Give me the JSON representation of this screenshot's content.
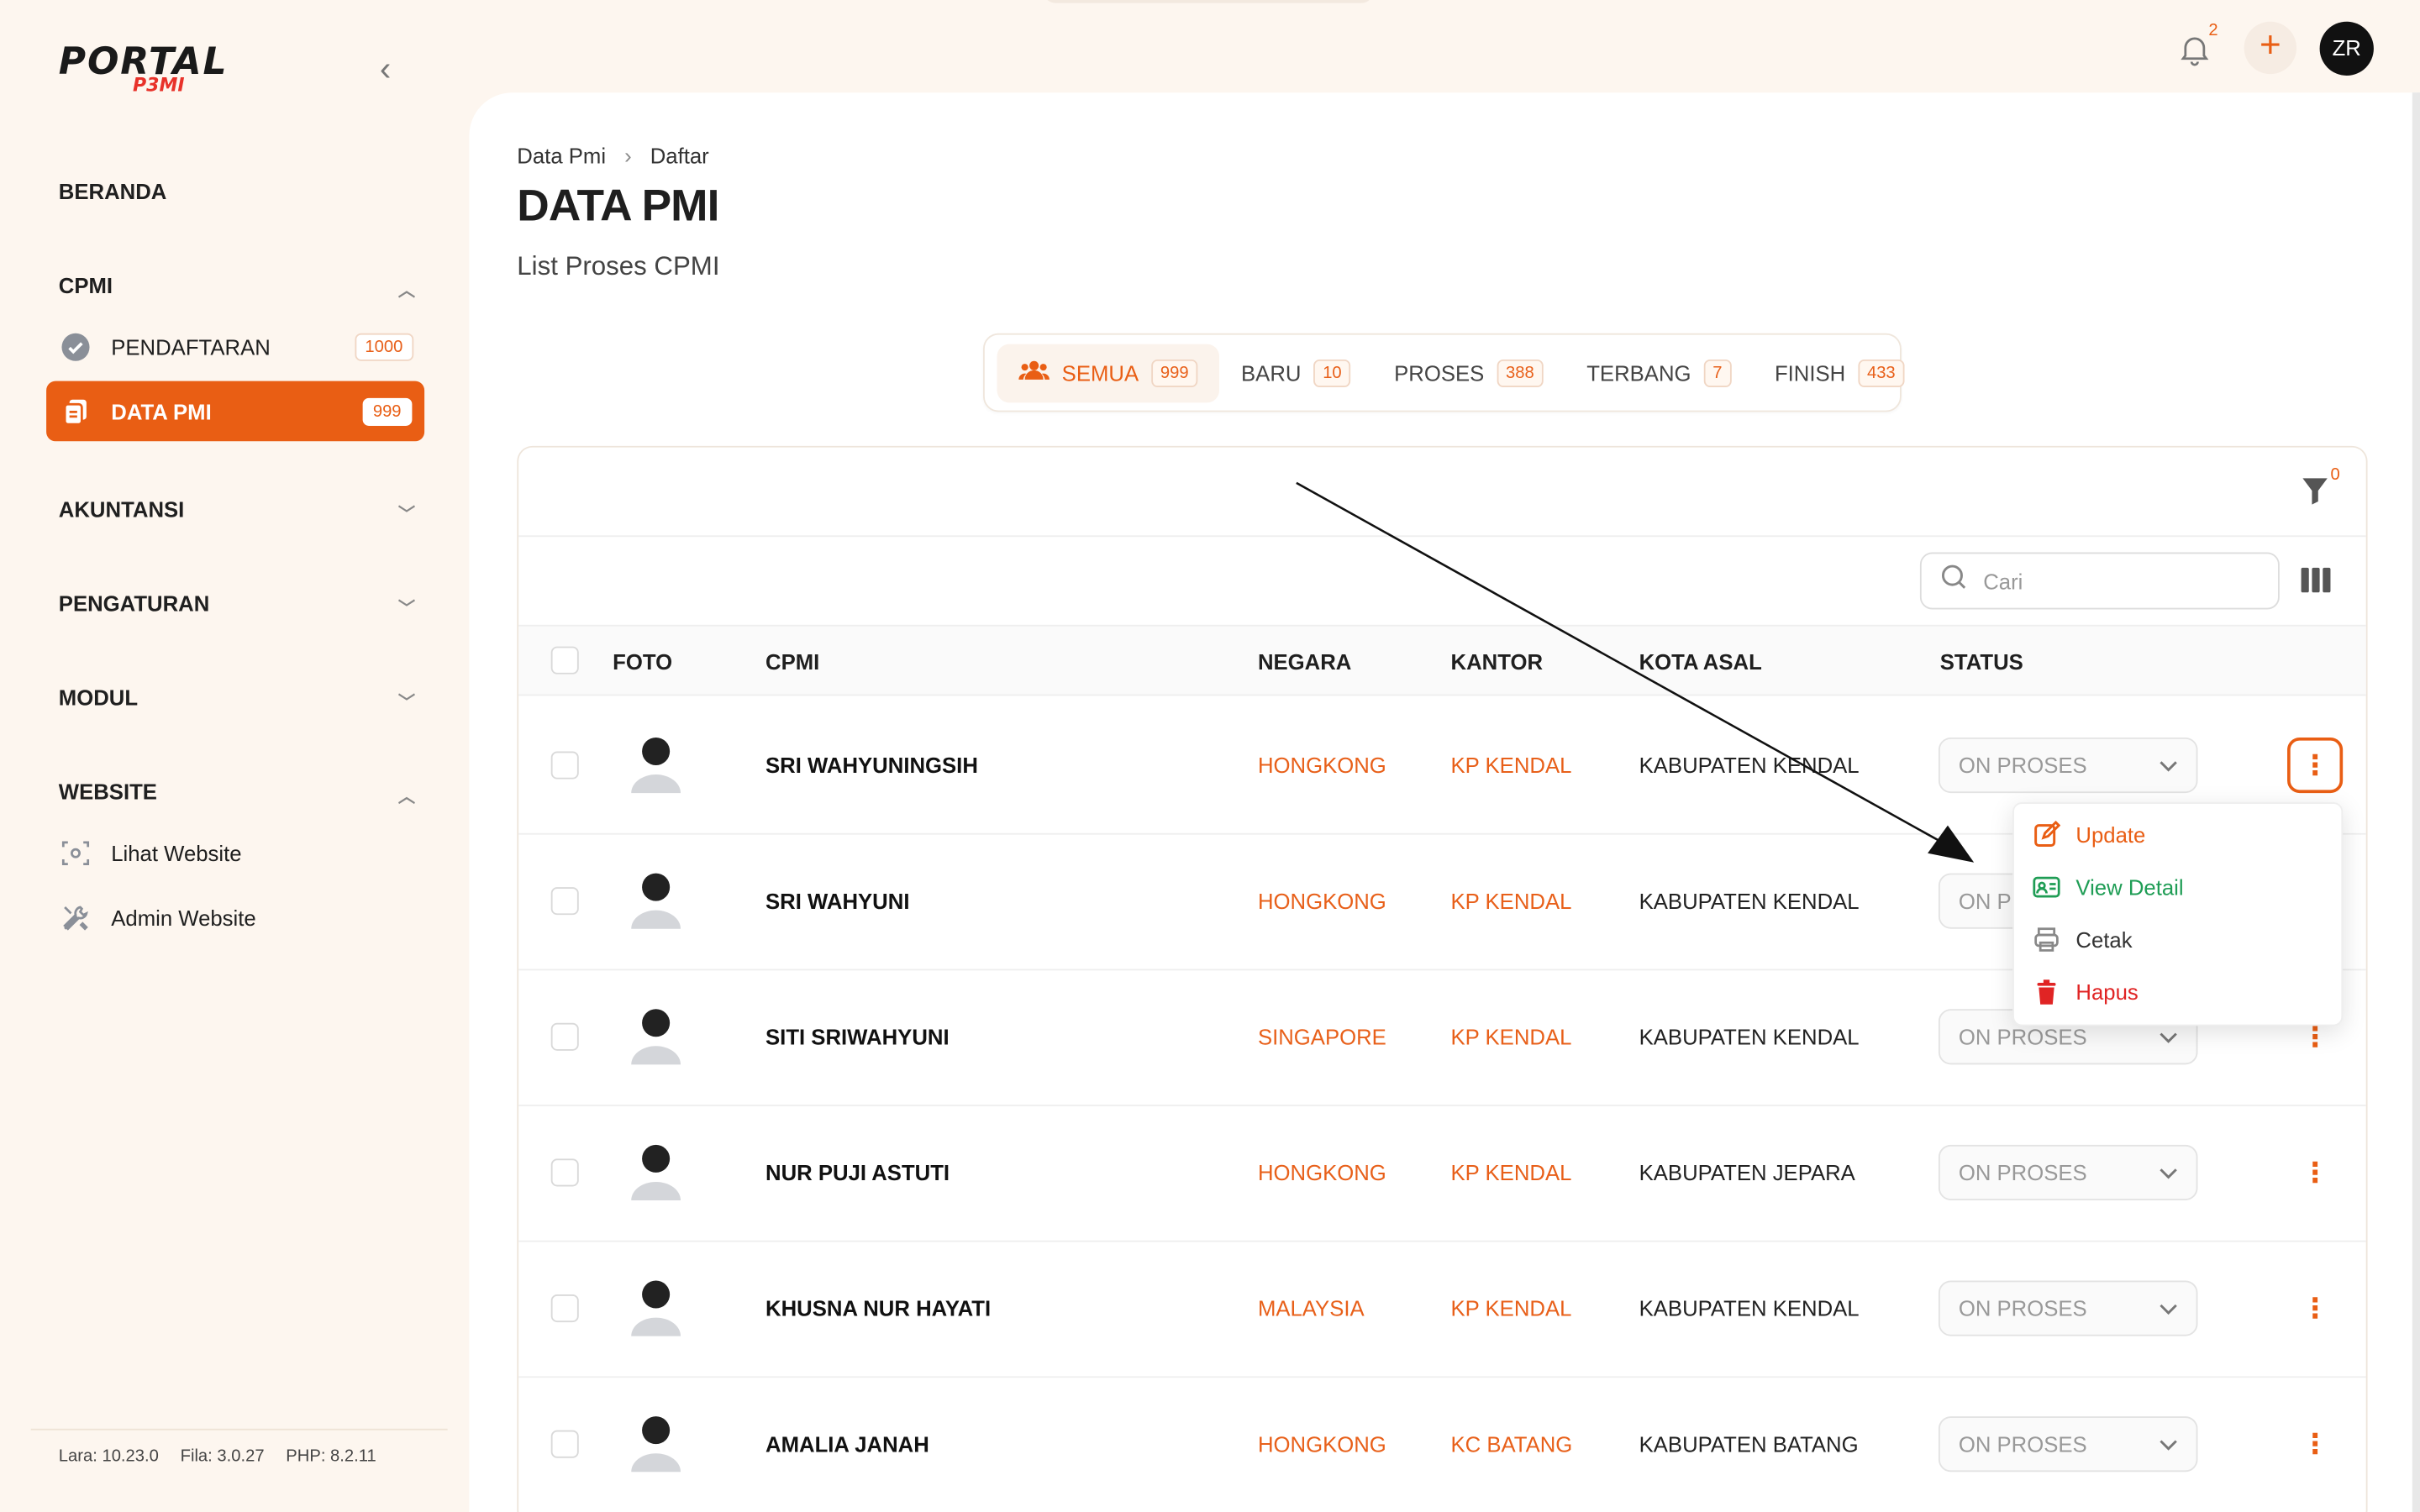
{
  "brand": {
    "logo_main": "PORTAL",
    "logo_sub": "P3MI"
  },
  "sidebar": {
    "beranda": "BERANDA",
    "cpmi": "CPMI",
    "pendaftaran": {
      "label": "PENDAFTARAN",
      "count": "1000"
    },
    "data_pmi": {
      "label": "DATA PMI",
      "count": "999"
    },
    "akuntansi": "AKUNTANSI",
    "pengaturan": "PENGATURAN",
    "modul": "MODUL",
    "website": "WEBSITE",
    "lihat_website": "Lihat Website",
    "admin_website": "Admin Website",
    "versions": {
      "lara": "Lara: 10.23.0",
      "fila": "Fila: 3.0.27",
      "php": "PHP: 8.2.11"
    }
  },
  "topbar": {
    "notif_count": "2",
    "user_initials": "ZR"
  },
  "header": {
    "breadcrumb": [
      "Data Pmi",
      "Daftar"
    ],
    "title": "DATA PMI",
    "subtitle": "List Proses CPMI"
  },
  "tabs": [
    {
      "label": "SEMUA",
      "count": "999"
    },
    {
      "label": "BARU",
      "count": "10"
    },
    {
      "label": "PROSES",
      "count": "388"
    },
    {
      "label": "TERBANG",
      "count": "7"
    },
    {
      "label": "FINISH",
      "count": "433"
    }
  ],
  "toolbar": {
    "filter_count": "0",
    "search_placeholder": "Cari"
  },
  "table": {
    "headers": {
      "foto": "FOTO",
      "cpmi": "CPMI",
      "negara": "NEGARA",
      "kantor": "KANTOR",
      "kota_asal": "KOTA ASAL",
      "status": "STATUS"
    },
    "rows": [
      {
        "name": "SRI WAHYUNINGSIH",
        "negara": "HONGKONG",
        "kantor": "KP KENDAL",
        "kota": "KABUPATEN KENDAL",
        "status": "ON PROSES"
      },
      {
        "name": "SRI WAHYUNI",
        "negara": "HONGKONG",
        "kantor": "KP KENDAL",
        "kota": "KABUPATEN KENDAL",
        "status": "ON PR"
      },
      {
        "name": "SITI SRIWAHYUNI",
        "negara": "SINGAPORE",
        "kantor": "KP KENDAL",
        "kota": "KABUPATEN KENDAL",
        "status": "ON PROSES"
      },
      {
        "name": "NUR PUJI ASTUTI",
        "negara": "HONGKONG",
        "kantor": "KP KENDAL",
        "kota": "KABUPATEN JEPARA",
        "status": "ON PROSES"
      },
      {
        "name": "KHUSNA NUR HAYATI",
        "negara": "MALAYSIA",
        "kantor": "KP KENDAL",
        "kota": "KABUPATEN KENDAL",
        "status": "ON PROSES"
      },
      {
        "name": "AMALIA JANAH",
        "negara": "HONGKONG",
        "kantor": "KC BATANG",
        "kota": "KABUPATEN BATANG",
        "status": "ON PROSES"
      }
    ]
  },
  "row_menu": {
    "update": "Update",
    "view_detail": "View Detail",
    "cetak": "Cetak",
    "hapus": "Hapus"
  },
  "colors": {
    "accent": "#e95e14",
    "green": "#1f9d55",
    "red": "#e02424",
    "sidebar_bg": "#fdf6ef"
  }
}
